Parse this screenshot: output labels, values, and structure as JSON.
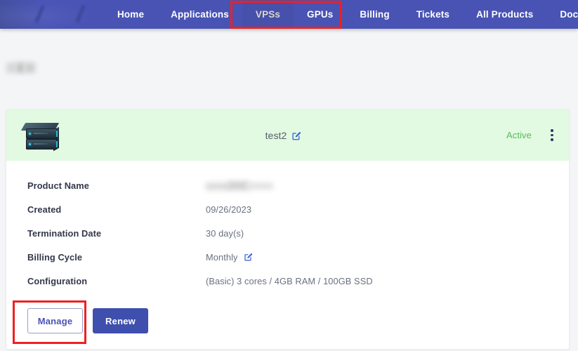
{
  "navbar": {
    "brand": {
      "redacted": true,
      "icon": "brand-logo-redacted"
    },
    "items": [
      {
        "label": "Home",
        "active": false
      },
      {
        "label": "Applications",
        "active": false
      },
      {
        "label": "VPSs",
        "active": true
      },
      {
        "label": "GPUs",
        "active": false
      },
      {
        "label": "Billing",
        "active": false
      },
      {
        "label": "Tickets",
        "active": false
      },
      {
        "label": "All Products",
        "active": false
      },
      {
        "label": "Docume",
        "active": false
      }
    ],
    "colors": {
      "background": "#4853b4",
      "active_background": "#4750ab",
      "active_text": "#ddd8c2",
      "text": "#ffffff"
    }
  },
  "page_heading": {
    "redacted": true
  },
  "annotations": [
    {
      "name": "nav-tabs-highlight",
      "color": "#ef2020",
      "targets": "VPSs, GPUs"
    },
    {
      "name": "manage-button-highlight",
      "color": "#ef2020",
      "targets": "Manage"
    }
  ],
  "service_card": {
    "header": {
      "icon": "server-stack-icon",
      "title": "test2",
      "title_edit_icon": "pencil-square-icon",
      "status": "Active",
      "status_color": "#5cb85c",
      "background_color": "#e1fae1",
      "menu_icon": "kebab-menu-icon"
    },
    "details": [
      {
        "label": "Product Name",
        "value": "",
        "redacted": true,
        "edit_icon": false
      },
      {
        "label": "Created",
        "value": "09/26/2023",
        "redacted": false,
        "edit_icon": false
      },
      {
        "label": "Termination Date",
        "value": "30 day(s)",
        "redacted": false,
        "edit_icon": false
      },
      {
        "label": "Billing Cycle",
        "value": "Monthly",
        "redacted": false,
        "edit_icon": true
      },
      {
        "label": "Configuration",
        "value": "(Basic) 3 cores / 4GB RAM / 100GB SSD",
        "redacted": false,
        "edit_icon": false
      }
    ],
    "actions": {
      "manage_label": "Manage",
      "renew_label": "Renew",
      "primary_color": "#3f4fae"
    }
  }
}
